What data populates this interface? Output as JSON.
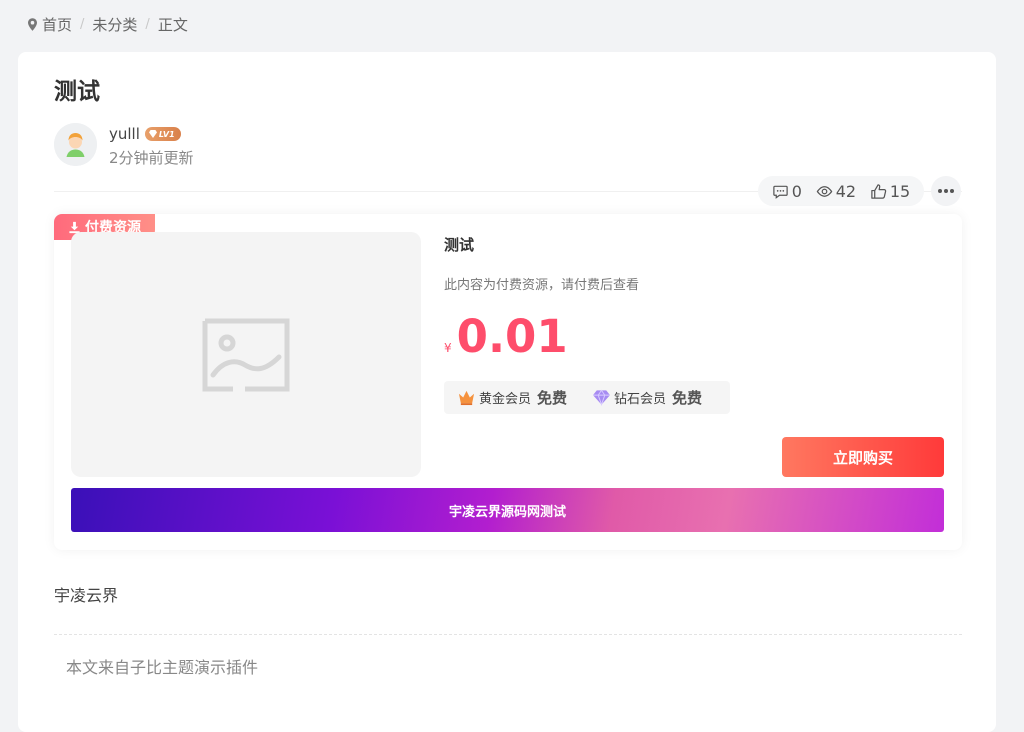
{
  "breadcrumb": {
    "home": "首页",
    "category": "未分类",
    "current": "正文"
  },
  "post": {
    "title": "测试",
    "author": "yulll",
    "level": "LV1",
    "updated": "2分钟前更新",
    "stats": {
      "comments": "0",
      "views": "42",
      "likes": "15"
    }
  },
  "resource": {
    "tag": "付费资源",
    "title": "测试",
    "desc": "此内容为付费资源，请付费后查看",
    "currency": "¥",
    "price": "0.01",
    "vip": [
      {
        "name": "黄金会员",
        "price": "免费"
      },
      {
        "name": "钻石会员",
        "price": "免费"
      }
    ],
    "buy_label": "立即购买",
    "banner": "宇凌云界源码网测试"
  },
  "content": {
    "paragraph": "宇凌云界",
    "source_note": "本文来自子比主题演示插件"
  },
  "colors": {
    "price": "#fe4d6b",
    "buy_button": "#ff3a3a",
    "paytag": "#ff6a7c"
  }
}
